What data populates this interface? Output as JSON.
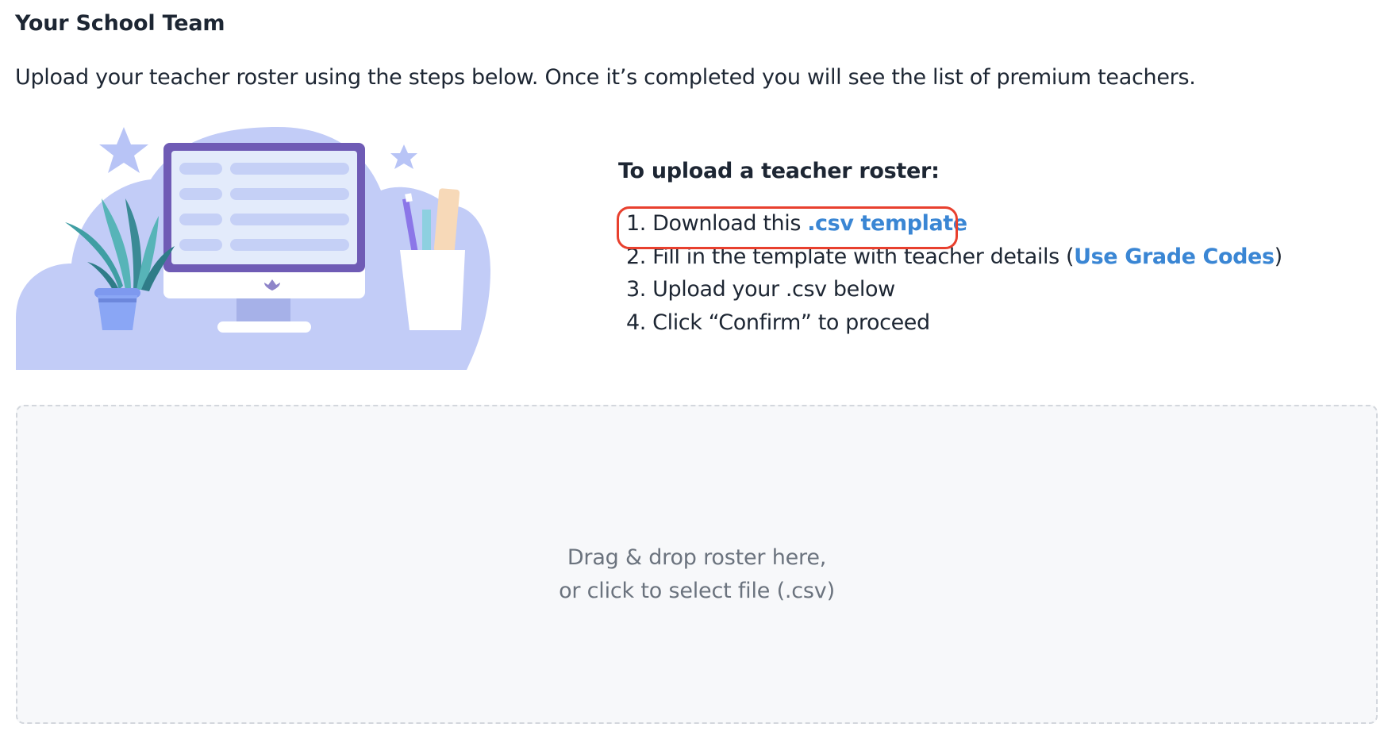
{
  "header": {
    "title": "Your School Team",
    "description": "Upload your teacher roster using the steps below. Once it’s completed you will see the list of premium teachers."
  },
  "illustration": {
    "icon": "desk-computer-illustration"
  },
  "instructions": {
    "heading": "To upload a teacher roster:",
    "steps": [
      {
        "number": "1.",
        "text": "Download this ",
        "link": ".csv template"
      },
      {
        "number": "2.",
        "text": "Fill in the template with teacher details (",
        "link": "Use Grade Codes",
        "suffix": ")"
      },
      {
        "number": "3.",
        "text": "Upload your .csv below"
      },
      {
        "number": "4.",
        "text": "Click “Confirm” to proceed"
      }
    ]
  },
  "dropzone": {
    "line1": "Drag & drop roster here,",
    "line2": "or click to select file (.csv)"
  },
  "colors": {
    "link": "#3a86d4",
    "highlight": "#e8402e",
    "illustration_primary": "#6f5bb5",
    "illustration_light": "#c2ccf7",
    "dropzone_bg": "#f7f8fa"
  }
}
